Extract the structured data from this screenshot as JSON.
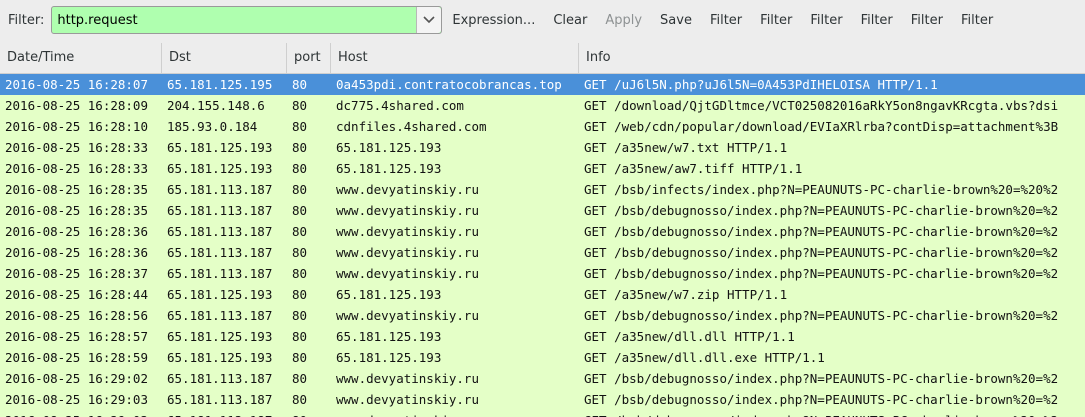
{
  "toolbar": {
    "filter_label": "Filter:",
    "filter_value": "http.request",
    "expression_label": "Expression...",
    "clear_label": "Clear",
    "apply_label": "Apply",
    "save_label": "Save",
    "extra_filters": [
      "Filter",
      "Filter",
      "Filter",
      "Filter",
      "Filter",
      "Filter"
    ],
    "dropdown_icon": "chevron-down-icon"
  },
  "table": {
    "columns": [
      "Date/Time",
      "Dst",
      "port",
      "Host",
      "Info"
    ],
    "rows": [
      {
        "time": "2016-08-25 16:28:07",
        "dst": "65.181.125.195",
        "port": "80",
        "host": "0a453pdi.contratocobrancas.top",
        "info": "GET /uJ6l5N.php?uJ6l5N=0A453PdIHELOISA HTTP/1.1",
        "selected": true
      },
      {
        "time": "2016-08-25 16:28:09",
        "dst": "204.155.148.6",
        "port": "80",
        "host": "dc775.4shared.com",
        "info": "GET /download/QjtGDltmce/VCT025082016aRkY5on8ngavKRcgta.vbs?dsi"
      },
      {
        "time": "2016-08-25 16:28:10",
        "dst": "185.93.0.184",
        "port": "80",
        "host": "cdnfiles.4shared.com",
        "info": "GET /web/cdn/popular/download/EVIaXRlrba?contDisp=attachment%3B"
      },
      {
        "time": "2016-08-25 16:28:33",
        "dst": "65.181.125.193",
        "port": "80",
        "host": "65.181.125.193",
        "info": "GET /a35new/w7.txt HTTP/1.1"
      },
      {
        "time": "2016-08-25 16:28:33",
        "dst": "65.181.125.193",
        "port": "80",
        "host": "65.181.125.193",
        "info": "GET /a35new/aw7.tiff HTTP/1.1"
      },
      {
        "time": "2016-08-25 16:28:35",
        "dst": "65.181.113.187",
        "port": "80",
        "host": "www.devyatinskiy.ru",
        "info": "GET /bsb/infects/index.php?N=PEAUNUTS-PC-charlie-brown%20=%20%2"
      },
      {
        "time": "2016-08-25 16:28:35",
        "dst": "65.181.113.187",
        "port": "80",
        "host": "www.devyatinskiy.ru",
        "info": "GET /bsb/debugnosso/index.php?N=PEAUNUTS-PC-charlie-brown%20=%2"
      },
      {
        "time": "2016-08-25 16:28:36",
        "dst": "65.181.113.187",
        "port": "80",
        "host": "www.devyatinskiy.ru",
        "info": "GET /bsb/debugnosso/index.php?N=PEAUNUTS-PC-charlie-brown%20=%2"
      },
      {
        "time": "2016-08-25 16:28:36",
        "dst": "65.181.113.187",
        "port": "80",
        "host": "www.devyatinskiy.ru",
        "info": "GET /bsb/debugnosso/index.php?N=PEAUNUTS-PC-charlie-brown%20=%2"
      },
      {
        "time": "2016-08-25 16:28:37",
        "dst": "65.181.113.187",
        "port": "80",
        "host": "www.devyatinskiy.ru",
        "info": "GET /bsb/debugnosso/index.php?N=PEAUNUTS-PC-charlie-brown%20=%2"
      },
      {
        "time": "2016-08-25 16:28:44",
        "dst": "65.181.125.193",
        "port": "80",
        "host": "65.181.125.193",
        "info": "GET /a35new/w7.zip HTTP/1.1"
      },
      {
        "time": "2016-08-25 16:28:56",
        "dst": "65.181.113.187",
        "port": "80",
        "host": "www.devyatinskiy.ru",
        "info": "GET /bsb/debugnosso/index.php?N=PEAUNUTS-PC-charlie-brown%20=%2"
      },
      {
        "time": "2016-08-25 16:28:57",
        "dst": "65.181.125.193",
        "port": "80",
        "host": "65.181.125.193",
        "info": "GET /a35new/dll.dll HTTP/1.1"
      },
      {
        "time": "2016-08-25 16:28:59",
        "dst": "65.181.125.193",
        "port": "80",
        "host": "65.181.125.193",
        "info": "GET /a35new/dll.dll.exe HTTP/1.1"
      },
      {
        "time": "2016-08-25 16:29:02",
        "dst": "65.181.113.187",
        "port": "80",
        "host": "www.devyatinskiy.ru",
        "info": "GET /bsb/debugnosso/index.php?N=PEAUNUTS-PC-charlie-brown%20=%2"
      },
      {
        "time": "2016-08-25 16:29:03",
        "dst": "65.181.113.187",
        "port": "80",
        "host": "www.devyatinskiy.ru",
        "info": "GET /bsb/debugnosso/index.php?N=PEAUNUTS-PC-charlie-brown%20=%2"
      },
      {
        "time": "2016-08-25 16:29:03",
        "dst": "65.181.113.187",
        "port": "80",
        "host": "www.devyatinskiy.ru",
        "info": "GET /bsb/debugnosso/index.php?N=PEAUNUTS-PC-charlie-brown%20=%2"
      }
    ]
  },
  "colors": {
    "filter_valid_bg": "#afffaf",
    "row_bg": "#e4ffc7",
    "selected_row_bg": "#4a90d9",
    "toolbar_bg": "#ededed"
  }
}
